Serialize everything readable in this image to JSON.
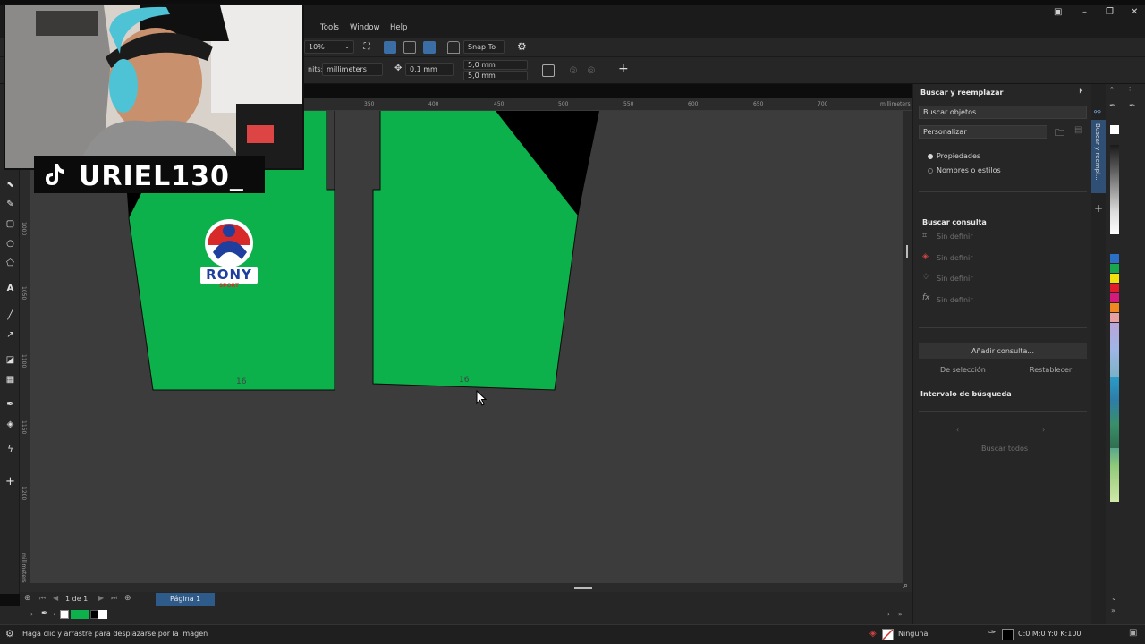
{
  "menu": {
    "tools": "Tools",
    "window": "Window",
    "help": "Help"
  },
  "toolbar": {
    "zoom": "10%",
    "snap": "Snap To",
    "units_label": "nits:",
    "units_value": "millimeters",
    "nudge": "0,1 mm",
    "dup_x": "5,0 mm",
    "dup_y": "5,0 mm"
  },
  "ruler": {
    "top_ticks": [
      "350",
      "400",
      "450",
      "500",
      "550",
      "600",
      "650",
      "700"
    ],
    "top_unit": "millimeters",
    "left_ticks": [
      "1000",
      "1050",
      "1100",
      "1150",
      "1200",
      "1250"
    ],
    "left_unit": "millimeters"
  },
  "canvas": {
    "piece_left_number": "16",
    "piece_right_number": "16",
    "logo_text": "RONY",
    "logo_subtext": "SPORT"
  },
  "pagenav": {
    "count": "1 de 1",
    "page_tab": "Página 1"
  },
  "status": {
    "hint": "Haga clic y arrastre para desplazarse por la imagen",
    "fill": "Ninguna",
    "outline": "C:0 M:0 Y:0 K:100"
  },
  "docker": {
    "title": "Buscar y reemplazar",
    "mode": "Buscar objetos",
    "preset": "Personalizar",
    "radio1": "Propiedades",
    "radio2": "Nombres o estilos",
    "query_title": "Buscar consulta",
    "undefined": [
      "Sin definir",
      "Sin definir",
      "Sin definir",
      "Sin definir"
    ],
    "add_query": "Añadir consulta...",
    "from_selection": "De selección",
    "reset": "Restablecer",
    "interval_title": "Intervalo de búsqueda",
    "find_all": "Buscar todos",
    "tab_label": "Buscar y reempl..."
  },
  "overlay": {
    "handle": "URIEL130_"
  },
  "colors": {
    "piece_green": "#0cb14b",
    "page_tab": "#2f5b8a",
    "accent": "#3b6ea5"
  }
}
